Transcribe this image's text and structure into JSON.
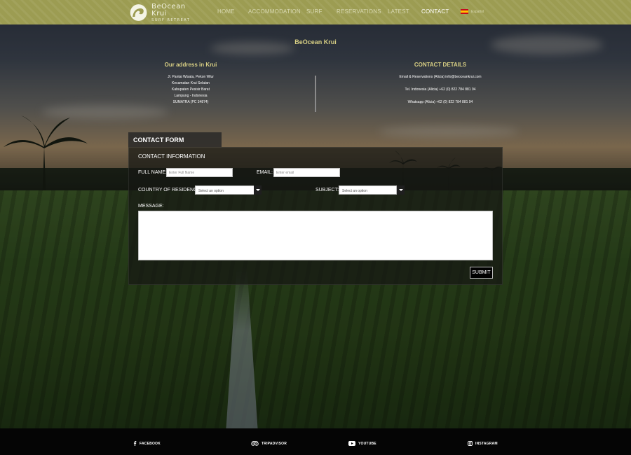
{
  "brand": {
    "title": "BeOcean Krui",
    "tagline": "SURF RETREAT"
  },
  "nav": {
    "items": [
      {
        "label": "HOME"
      },
      {
        "label": "ACCOMMODATION"
      },
      {
        "label": "SURF"
      },
      {
        "label": "RESERVATIONS"
      },
      {
        "label": "LATEST"
      },
      {
        "label": "CONTACT",
        "active": true
      }
    ],
    "language": {
      "label": "Español",
      "flag_icon": "spain-flag-icon"
    }
  },
  "info": {
    "site_name": "BeOcean Krui",
    "address": {
      "title": "Our address in Krui",
      "lines": [
        "Jl. Pantai Wisata, Pekon Wlur",
        "Kecamatan Krui Selatan",
        "Kabupaten Pesisir Barat",
        "Lampung - Indonesia",
        "SUMATRA (PC 34874)"
      ]
    },
    "contact": {
      "title": "CONTACT DETAILS",
      "email": "Email & Reservations (Alicia) info@beoceankrui.com",
      "tel": "Tel. Indonesia (Alicia) +62 (0) 822 784 881 94",
      "whatsapp": "Whatsapp (Alicia) +62 (0) 822 784 881 94"
    }
  },
  "form": {
    "tab_label": "CONTACT FORM",
    "section_title": "CONTACT INFORMATION",
    "full_name": {
      "label": "FULL NAME:",
      "placeholder": "Enter Full Name",
      "value": ""
    },
    "email": {
      "label": "EMAIL:",
      "placeholder": "Enter email",
      "value": ""
    },
    "country": {
      "label": "COUNTRY OF RESIDENCE:",
      "selected": "Select an option"
    },
    "subject": {
      "label": "SUBJECT:",
      "selected": "Select an option"
    },
    "message": {
      "label": "MESSAGE:",
      "value": ""
    },
    "submit_label": "SUBMIT"
  },
  "footer": {
    "links": [
      {
        "label": "FACEBOOK",
        "icon": "facebook-icon"
      },
      {
        "label": "TRIPADVISOR",
        "icon": "tripadvisor-icon"
      },
      {
        "label": "YOUTUBE",
        "icon": "youtube-icon"
      },
      {
        "label": "INSTAGRAM",
        "icon": "instagram-icon"
      }
    ]
  },
  "colors": {
    "navbar": "#9c9c52",
    "accent_gold": "#d8cf84",
    "footer": "#050505"
  }
}
